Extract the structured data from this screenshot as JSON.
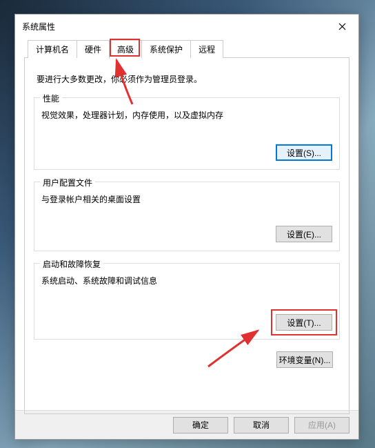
{
  "titlebar": {
    "title": "系统属性"
  },
  "tabs": {
    "items": [
      "计算机名",
      "硬件",
      "高级",
      "系统保护",
      "远程"
    ],
    "active_index": 2
  },
  "intro": "要进行大多数更改，你必须作为管理员登录。",
  "group_performance": {
    "title": "性能",
    "desc": "视觉效果，处理器计划，内存使用，以及虚拟内存",
    "button": "设置(S)..."
  },
  "group_userprofile": {
    "title": "用户配置文件",
    "desc": "与登录帐户相关的桌面设置",
    "button": "设置(E)..."
  },
  "group_startup": {
    "title": "启动和故障恢复",
    "desc": "系统启动、系统故障和调试信息",
    "button": "设置(T)..."
  },
  "env_button": "环境变量(N)...",
  "footer": {
    "ok": "确定",
    "cancel": "取消",
    "apply": "应用(A)"
  }
}
